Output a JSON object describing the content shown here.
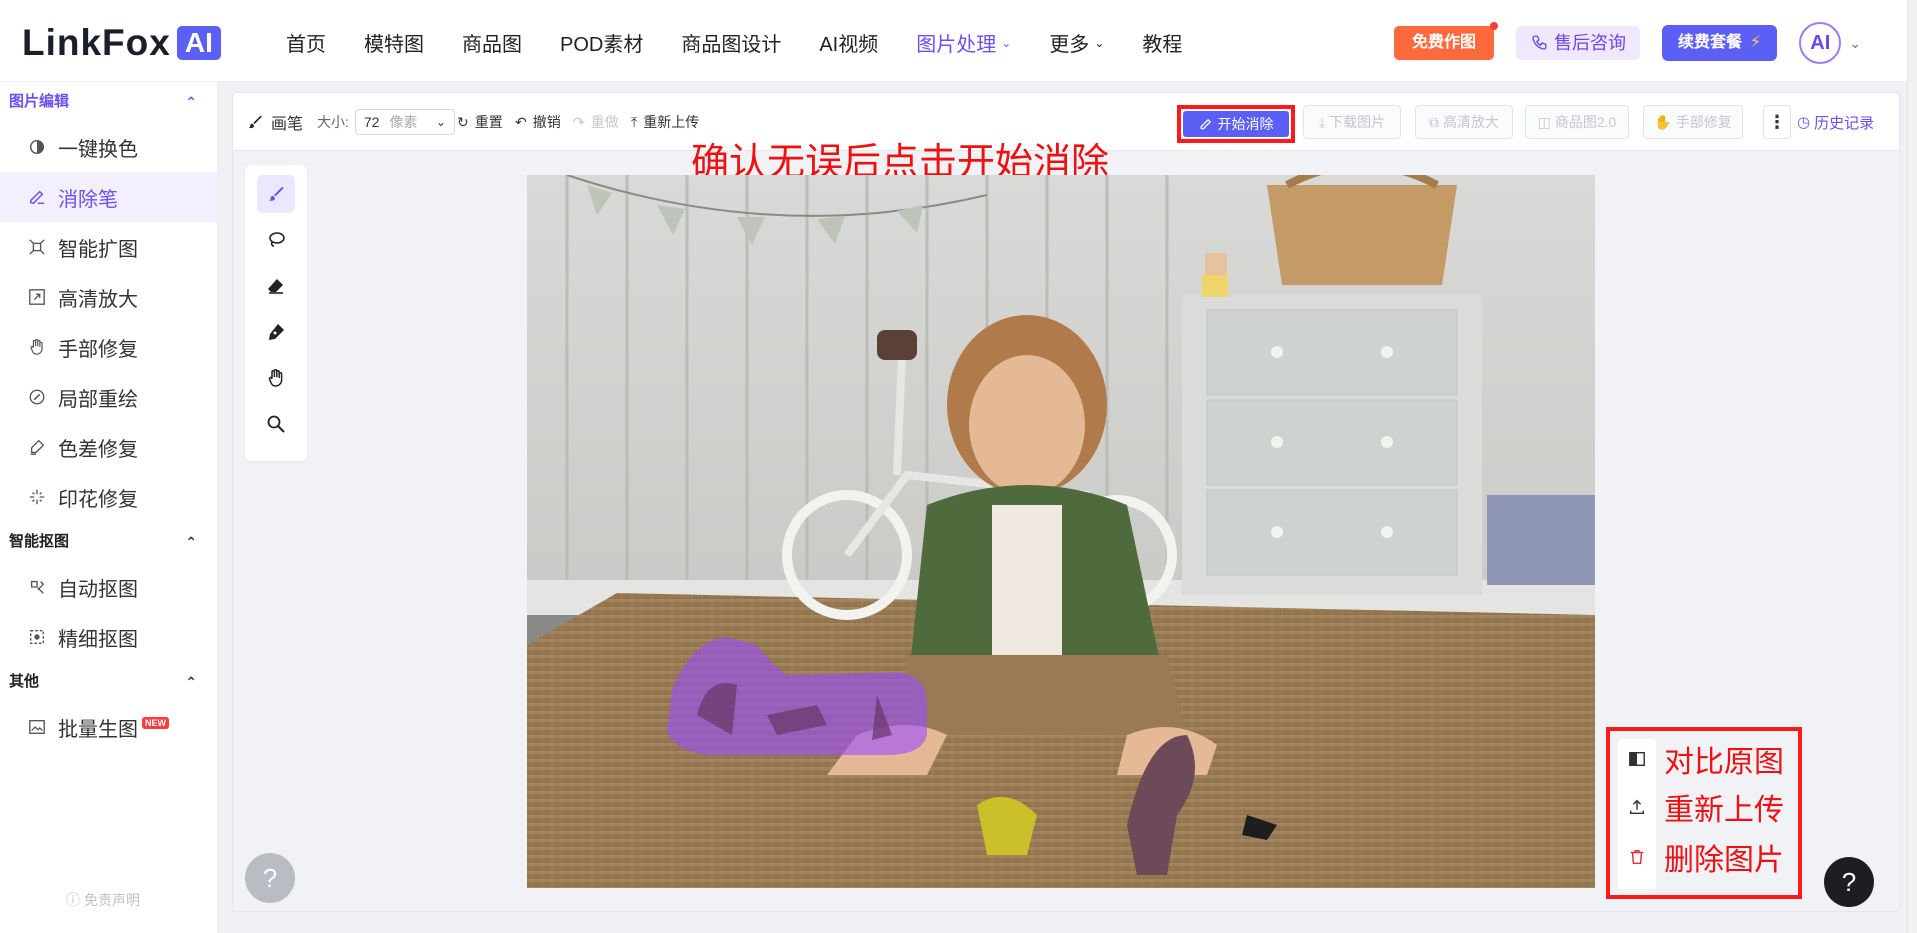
{
  "brand": {
    "name": "LinkFox",
    "badge": "AI"
  },
  "nav": {
    "items": [
      {
        "label": "首页",
        "active": false,
        "dropdown": false
      },
      {
        "label": "模特图",
        "active": false,
        "dropdown": false
      },
      {
        "label": "商品图",
        "active": false,
        "dropdown": false
      },
      {
        "label": "POD素材",
        "active": false,
        "dropdown": false
      },
      {
        "label": "商品图设计",
        "active": false,
        "dropdown": false
      },
      {
        "label": "AI视频",
        "active": false,
        "dropdown": false
      },
      {
        "label": "图片处理",
        "active": true,
        "dropdown": true
      },
      {
        "label": "更多",
        "active": false,
        "dropdown": true
      },
      {
        "label": "教程",
        "active": false,
        "dropdown": false
      }
    ],
    "free_btn": "免费作图",
    "consult_btn": "售后咨询",
    "renew_btn": "续费套餐",
    "avatar_text": "AI"
  },
  "sidebar": {
    "sections": [
      {
        "title": "图片编辑",
        "active": true,
        "items": [
          {
            "label": "一键换色",
            "icon": "color-swap-icon",
            "active": false
          },
          {
            "label": "消除笔",
            "icon": "eraser-pen-icon",
            "active": true
          },
          {
            "label": "智能扩图",
            "icon": "expand-icon",
            "active": false
          },
          {
            "label": "高清放大",
            "icon": "upscale-icon",
            "active": false
          },
          {
            "label": "手部修复",
            "icon": "hand-icon",
            "active": false
          },
          {
            "label": "局部重绘",
            "icon": "repaint-icon",
            "active": false
          },
          {
            "label": "色差修复",
            "icon": "color-fix-icon",
            "active": false
          },
          {
            "label": "印花修复",
            "icon": "print-fix-icon",
            "active": false
          }
        ]
      },
      {
        "title": "智能抠图",
        "active": false,
        "items": [
          {
            "label": "自动抠图",
            "icon": "auto-cutout-icon",
            "active": false
          },
          {
            "label": "精细抠图",
            "icon": "fine-cutout-icon",
            "active": false
          }
        ]
      },
      {
        "title": "其他",
        "active": false,
        "items": [
          {
            "label": "批量生图",
            "icon": "batch-image-icon",
            "active": false,
            "badge": "NEW"
          }
        ]
      }
    ],
    "disclaimer": "免责声明"
  },
  "toolbar": {
    "brush_label": "画笔",
    "size_label": "大小:",
    "size_value": "72",
    "size_unit": "像素",
    "reset": "重置",
    "undo": "撤销",
    "redo": "重做",
    "reupload": "重新上传",
    "start": "开始消除",
    "download": "下载图片",
    "upscale": "高清放大",
    "product": "商品图2.0",
    "handfix": "手部修复",
    "more": "⋮",
    "history": "历史记录"
  },
  "annotation": {
    "hint": "确认无误后点击开始消除",
    "compare": "对比原图",
    "reupload": "重新上传",
    "delete": "删除图片"
  },
  "help": "?",
  "colors": {
    "accent": "#6d4ff5",
    "primary_btn": "#5b5ff5",
    "annotation_red": "#ee1111",
    "mask": "#9b4dff"
  }
}
